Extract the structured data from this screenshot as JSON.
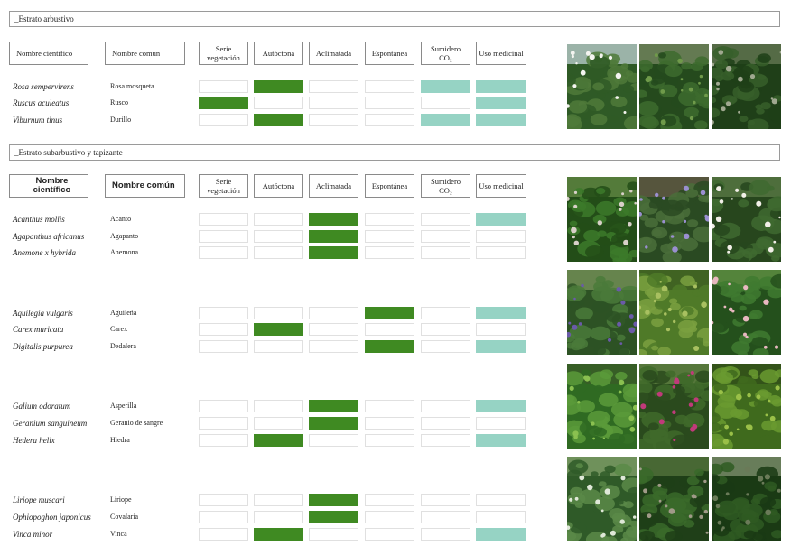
{
  "colors": {
    "autoctona": "#3f8a22",
    "sumidero_medicinal": "#96d3c4",
    "empty_cell_border": "#e0e0e0",
    "header_border": "#8a8a8a"
  },
  "sections": [
    {
      "title": "_Estrato arbustivo",
      "headers": [
        "Nombre científico",
        "Nombre común",
        "Serie\nvegetación",
        "Autóctona",
        "Aclimatada",
        "Espontánea",
        "Sumidero\nCO₂",
        "Uso medicinal"
      ],
      "rows": [
        {
          "scientific": "Rosa sempervirens",
          "common": "Rosa mosqueta",
          "cells": [
            "",
            "green",
            "",
            "",
            "teal",
            "teal"
          ]
        },
        {
          "scientific": "Ruscus aculeatus",
          "common": "Rusco",
          "cells": [
            "green",
            "",
            "",
            "",
            "",
            "teal"
          ]
        },
        {
          "scientific": "Viburnum tinus",
          "common": "Durillo",
          "cells": [
            "",
            "green",
            "",
            "",
            "teal",
            "teal"
          ]
        }
      ],
      "photos": [
        "white-rose-shrub-photo",
        "ruscus-shrub-photo",
        "viburnum-shrub-photo"
      ]
    },
    {
      "title": "_Estrato subarbustivo y tapizante",
      "headers": [
        "Nombre científico",
        "Nombre común",
        "Serie\nvegetación",
        "Autóctona",
        "Aclimatada",
        "Espontánea",
        "Sumidero\nCO₂",
        "Uso medicinal"
      ],
      "groups": [
        {
          "rows": [
            {
              "scientific": "Acanthus mollis",
              "common": "Acanto",
              "cells": [
                "",
                "",
                "green",
                "",
                "",
                "teal"
              ]
            },
            {
              "scientific": "Agapanthus africanus",
              "common": "Agapanto",
              "cells": [
                "",
                "",
                "green",
                "",
                "",
                ""
              ]
            },
            {
              "scientific": "Anemone x hybrida",
              "common": "Anemona",
              "cells": [
                "",
                "",
                "green",
                "",
                "",
                ""
              ]
            }
          ],
          "photos": [
            "acanthus-photo",
            "agapanthus-photo",
            "anemone-photo"
          ]
        },
        {
          "rows": [
            {
              "scientific": "Aquilegia vulgaris",
              "common": "Aguileña",
              "cells": [
                "",
                "",
                "",
                "green",
                "",
                "teal"
              ]
            },
            {
              "scientific": "Carex muricata",
              "common": "Carex",
              "cells": [
                "",
                "green",
                "",
                "",
                "",
                ""
              ]
            },
            {
              "scientific": "Digitalis purpurea",
              "common": "Dedalera",
              "cells": [
                "",
                "",
                "",
                "green",
                "",
                "teal"
              ]
            }
          ],
          "photos": [
            "aquilegia-photo",
            "carex-photo",
            "digitalis-photo"
          ]
        },
        {
          "rows": [
            {
              "scientific": "Galium odoratum",
              "common": "Asperilla",
              "cells": [
                "",
                "",
                "green",
                "",
                "",
                "teal"
              ]
            },
            {
              "scientific": "Geranium sanguineum",
              "common": "Geranio de sangre",
              "cells": [
                "",
                "",
                "green",
                "",
                "",
                ""
              ]
            },
            {
              "scientific": "Hedera helix",
              "common": "Hiedra",
              "cells": [
                "",
                "green",
                "",
                "",
                "",
                "teal"
              ]
            }
          ],
          "photos": [
            "galium-photo",
            "geranium-photo",
            "hedera-photo"
          ]
        },
        {
          "rows": [
            {
              "scientific": "Liriope muscari",
              "common": "Liriope",
              "cells": [
                "",
                "",
                "green",
                "",
                "",
                ""
              ]
            },
            {
              "scientific": "Ophiopoghon japonicus",
              "common": "Covalaria",
              "cells": [
                "",
                "",
                "green",
                "",
                "",
                ""
              ]
            },
            {
              "scientific": "Vinca minor",
              "common": "Vinca",
              "cells": [
                "",
                "green",
                "",
                "",
                "",
                "teal"
              ]
            }
          ],
          "photos": [
            "liriope-photo",
            "ophiopogon-photo",
            "vinca-photo"
          ]
        }
      ]
    }
  ]
}
